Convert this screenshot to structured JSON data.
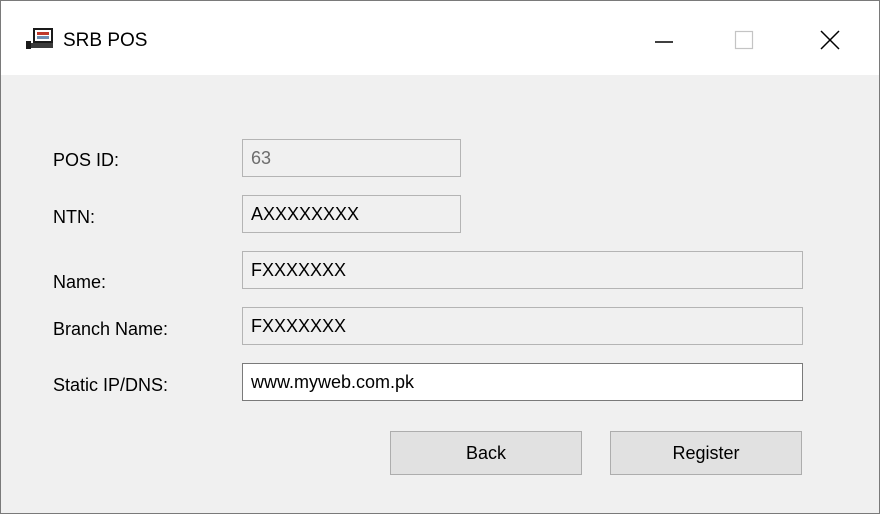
{
  "window": {
    "title": "SRB POS",
    "icon": "register-terminal-icon",
    "controls": {
      "minimize": "minimize-icon",
      "maximize": "maximize-icon",
      "close": "close-icon"
    }
  },
  "form": {
    "pos_id": {
      "label": "POS ID:",
      "value": "63"
    },
    "ntn": {
      "label": "NTN:",
      "value": "AXXXXXXXX"
    },
    "name": {
      "label": "Name:",
      "value": "FXXXXXXX"
    },
    "branch_name": {
      "label": "Branch Name:",
      "value": "FXXXXXXX"
    },
    "static_ip": {
      "label": "Static IP/DNS:",
      "value": "www.myweb.com.pk"
    }
  },
  "buttons": {
    "back": "Back",
    "register": "Register"
  },
  "colors": {
    "window_bg": "#f0f0f0",
    "titlebar_bg": "#ffffff",
    "button_bg": "#e1e1e1",
    "field_border": "#b4b4b4"
  }
}
